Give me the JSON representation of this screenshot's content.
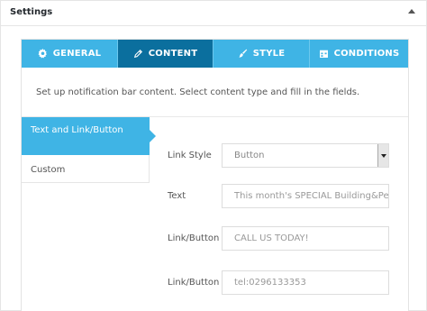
{
  "panel": {
    "title": "Settings"
  },
  "tabs": [
    {
      "label": "GENERAL",
      "icon": "gear-icon"
    },
    {
      "label": "CONTENT",
      "icon": "pencil-icon",
      "active": true
    },
    {
      "label": "STYLE",
      "icon": "paint-brush-icon"
    },
    {
      "label": "CONDITIONS",
      "icon": "calendar-icon"
    }
  ],
  "description": "Set up notification bar content. Select content type and fill in the fields.",
  "subnav": [
    {
      "label": "Text and Link/Button",
      "active": true
    },
    {
      "label": "Custom"
    }
  ],
  "fields": {
    "link_style": {
      "label": "Link Style",
      "value": "Button"
    },
    "text": {
      "label": "Text",
      "value": "This month's SPECIAL Building&Pest"
    },
    "link_button_text": {
      "label": "Link/Button Text",
      "value": "CALL US TODAY!"
    },
    "link_button_url": {
      "label": "Link/Button Url",
      "value": "tel:0296133353"
    }
  },
  "colors": {
    "accent": "#3fb4e5",
    "active_tab": "#0b6f9e"
  }
}
